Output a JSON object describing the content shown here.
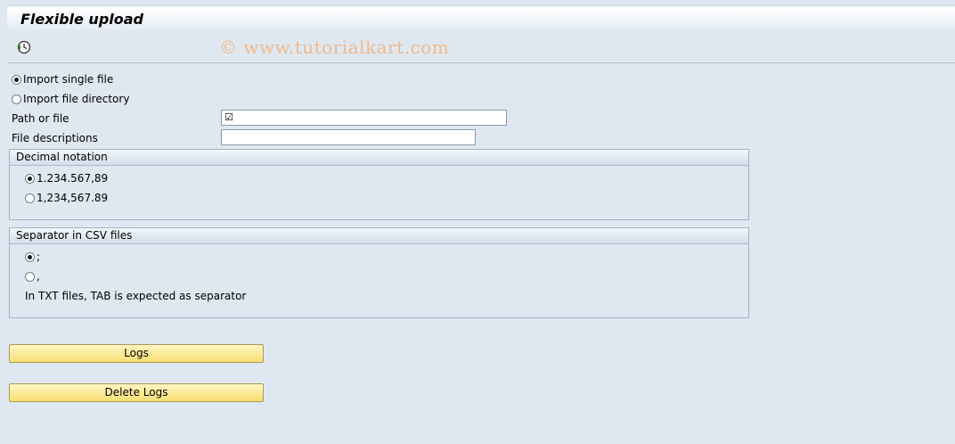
{
  "window": {
    "title": "Flexible upload"
  },
  "toolbar": {
    "execute_icon": "execute-clock-icon",
    "watermark": "© www.tutorialkart.com"
  },
  "import_mode": {
    "options": [
      {
        "label": "Import single file",
        "selected": true
      },
      {
        "label": "Import file directory",
        "selected": false
      }
    ]
  },
  "fields": {
    "path": {
      "label": "Path or file",
      "value": ""
    },
    "descriptions": {
      "label": "File descriptions",
      "value": ""
    }
  },
  "decimal_notation": {
    "title": "Decimal notation",
    "options": [
      {
        "label": "1.234.567,89",
        "selected": true
      },
      {
        "label": "1,234,567.89",
        "selected": false
      }
    ]
  },
  "separator": {
    "title": "Separator in CSV files",
    "options": [
      {
        "label": ";",
        "selected": true
      },
      {
        "label": ",",
        "selected": false
      }
    ],
    "note": "In TXT files, TAB is expected as separator"
  },
  "buttons": {
    "logs": "Logs",
    "delete_logs": "Delete Logs"
  },
  "colors": {
    "background": "#dfe8f1",
    "button": "#f7df73",
    "watermark": "#f0b88a"
  }
}
